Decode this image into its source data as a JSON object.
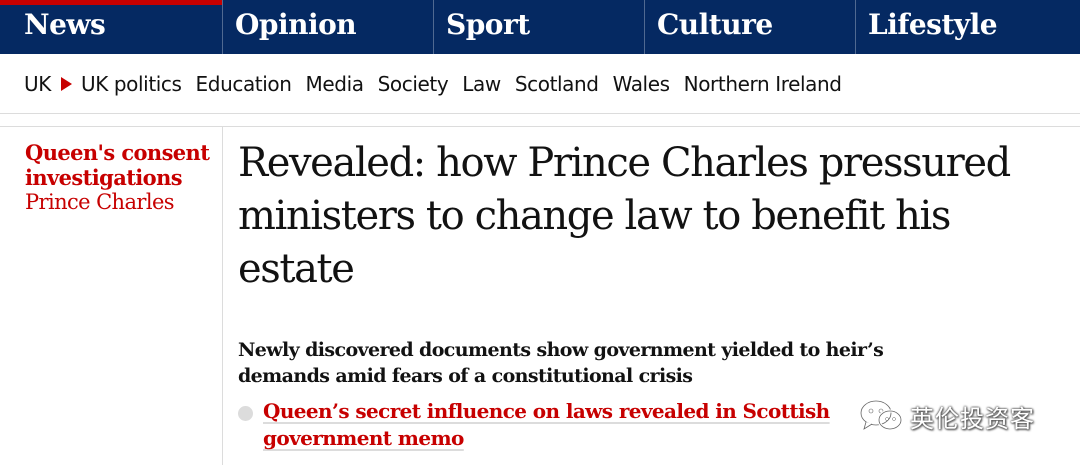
{
  "nav": {
    "pillars": [
      "News",
      "Opinion",
      "Sport",
      "Culture",
      "Lifestyle"
    ],
    "active_pillar": "News",
    "colors": {
      "background": "#052962",
      "accent": "#c70000"
    }
  },
  "subnav": {
    "section": "UK",
    "items": [
      "UK politics",
      "Education",
      "Media",
      "Society",
      "Law",
      "Scotland",
      "Wales",
      "Northern Ireland"
    ]
  },
  "article": {
    "series_kicker": "Queen's consent investigations",
    "series_tag": "Prince Charles",
    "headline": "Revealed: how Prince Charles pressured ministers to change law to benefit his estate",
    "standfirst": "Newly discovered documents show government yielded to heir’s demands amid fears of a constitutional crisis",
    "related_link": "Queen’s secret influence on laws revealed in Scottish government memo"
  },
  "watermark": {
    "icon": "wechat-icon",
    "text": "英伦投资客"
  }
}
